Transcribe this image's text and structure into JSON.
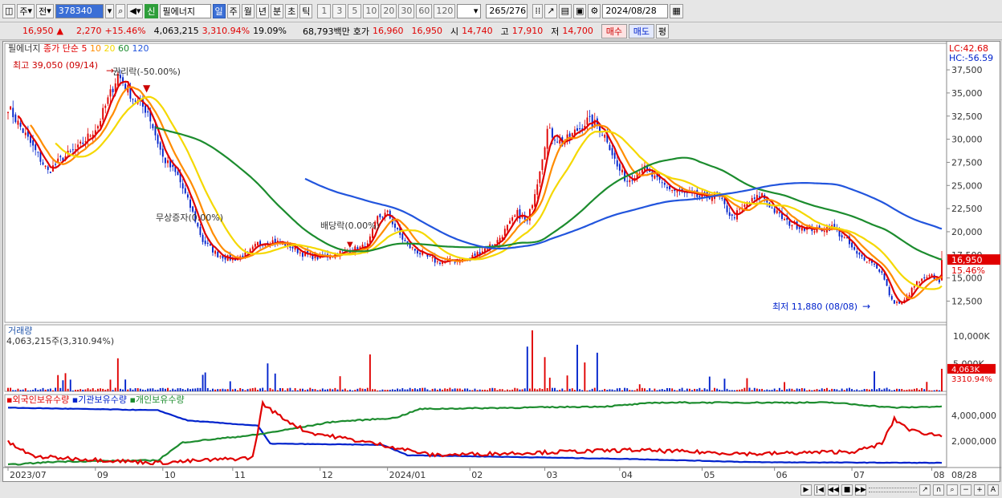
{
  "toolbar": {
    "mode_label": "주",
    "prev_label": "전",
    "code": "378340",
    "new_badge": "신",
    "stock_name": "필에너지",
    "periods": [
      "일",
      "주",
      "월",
      "년",
      "분",
      "초",
      "틱"
    ],
    "active_period": "일",
    "minutes": [
      "1",
      "3",
      "5",
      "10",
      "20",
      "30",
      "60",
      "120"
    ],
    "count": "265",
    "count_total": "/276",
    "date": "2024/08/28"
  },
  "quote": {
    "price": "16,950",
    "change": "2,270",
    "change_pct": "+15.46%",
    "volume": "4,063,215",
    "volume_ratio": "3,310.94%",
    "turnover": "19.09%",
    "amount": "68,793백만",
    "ask_label": "호가",
    "ask": "16,960",
    "bid": "16,950",
    "open_label": "시",
    "open": "14,740",
    "high_label": "고",
    "high": "17,910",
    "low_label": "저",
    "low": "14,700",
    "buy_label": "매수",
    "sell_label": "매도",
    "eval_label": "평"
  },
  "colors": {
    "up": "#e00000",
    "down": "#0022cc",
    "ma5": "#e00000",
    "ma10": "#ff8c00",
    "ma20": "#f5d800",
    "ma60": "#1c8c2e",
    "ma120": "#2255dd"
  },
  "chart_data": {
    "type": "candlestick",
    "indicator": {
      "name": "필에너지",
      "price_type": "종가",
      "method": "단순",
      "periods": [
        "5",
        "10",
        "20",
        "60",
        "120"
      ]
    },
    "lc": "LC:42.68",
    "hc": "HC:-56.59",
    "price_ticks": [
      "37,500",
      "35,000",
      "32,500",
      "30,000",
      "27,500",
      "25,000",
      "22,500",
      "20,000",
      "17,500",
      "15,000",
      "12,500"
    ],
    "price_range": [
      10200,
      39500
    ],
    "current_price_label": "16,950",
    "current_pct_label": "15.46%",
    "annotations": {
      "high": "최고 39,050 (09/14)",
      "split": "권리락(-50.00%)",
      "bonus": "무상증자(0.00%)",
      "dividend": "배당락(0.00%)",
      "low": "최저 11,880 (08/08)"
    },
    "volume_title": "거래량",
    "volume_info": "4,063,215주(3,310.94%)",
    "volume_ticks": [
      "10,000K",
      "5,000K"
    ],
    "volume_current": "4,063K",
    "volume_current_pct": "3310.94%",
    "holding_series": [
      "외국인보유수량",
      "기관보유수량",
      "개인보유수량"
    ],
    "holding_ticks": [
      "4,000,000",
      "2,000,000"
    ],
    "x_labels": [
      "2023/07",
      "09",
      "10",
      "11",
      "12",
      "2024/01",
      "02",
      "03",
      "04",
      "05",
      "06",
      "07",
      "08",
      "08/28"
    ],
    "close_anchors": [
      [
        0,
        33500
      ],
      [
        8,
        30000
      ],
      [
        16,
        26500
      ],
      [
        22,
        28000
      ],
      [
        28,
        29000
      ],
      [
        36,
        31500
      ],
      [
        44,
        37000
      ],
      [
        50,
        34500
      ],
      [
        56,
        33000
      ],
      [
        62,
        28000
      ],
      [
        68,
        26000
      ],
      [
        74,
        22000
      ],
      [
        78,
        19000
      ],
      [
        84,
        17500
      ],
      [
        90,
        17000
      ],
      [
        96,
        17600
      ],
      [
        100,
        18700
      ],
      [
        106,
        19000
      ],
      [
        112,
        18600
      ],
      [
        118,
        17600
      ],
      [
        124,
        17200
      ],
      [
        130,
        17500
      ],
      [
        136,
        18000
      ],
      [
        140,
        18200
      ],
      [
        144,
        18500
      ],
      [
        148,
        21500
      ],
      [
        152,
        22000
      ],
      [
        156,
        20000
      ],
      [
        160,
        18500
      ],
      [
        166,
        17500
      ],
      [
        172,
        16700
      ],
      [
        178,
        16900
      ],
      [
        184,
        17000
      ],
      [
        190,
        18000
      ],
      [
        196,
        19000
      ],
      [
        200,
        20500
      ],
      [
        204,
        22000
      ],
      [
        208,
        21000
      ],
      [
        212,
        25500
      ],
      [
        216,
        31000
      ],
      [
        222,
        29500
      ],
      [
        228,
        31000
      ],
      [
        232,
        32000
      ],
      [
        236,
        31500
      ],
      [
        240,
        30000
      ],
      [
        244,
        27000
      ],
      [
        248,
        25500
      ],
      [
        254,
        27000
      ],
      [
        260,
        25500
      ],
      [
        266,
        24500
      ],
      [
        272,
        24000
      ],
      [
        278,
        23700
      ],
      [
        284,
        24000
      ],
      [
        290,
        21500
      ],
      [
        296,
        23000
      ],
      [
        302,
        24000
      ],
      [
        306,
        22500
      ],
      [
        312,
        21000
      ],
      [
        318,
        20500
      ],
      [
        324,
        20200
      ],
      [
        330,
        20500
      ],
      [
        336,
        19000
      ],
      [
        340,
        17500
      ],
      [
        346,
        16800
      ],
      [
        350,
        15500
      ],
      [
        354,
        12500
      ],
      [
        358,
        12200
      ],
      [
        364,
        14500
      ],
      [
        370,
        15200
      ],
      [
        373,
        14700
      ],
      [
        374,
        16950
      ]
    ]
  }
}
